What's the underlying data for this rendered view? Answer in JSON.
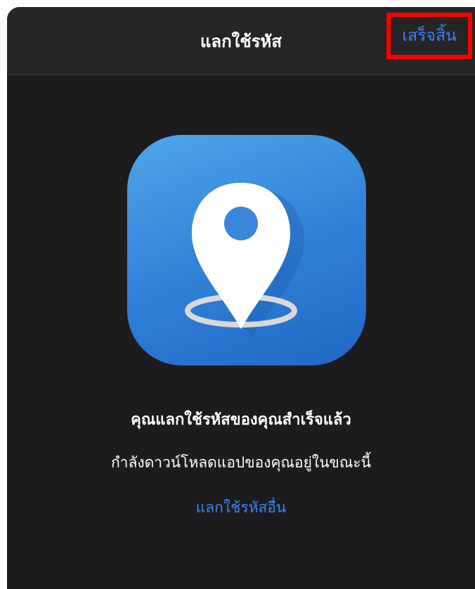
{
  "nav": {
    "title": "แลกใช้รหัส",
    "done_label": "เสร็จสิ้น"
  },
  "app_icon": {
    "icon": "location-pin-icon",
    "gradient_colors": [
      "#4fa6e9",
      "#2068c4"
    ]
  },
  "content": {
    "success_message": "คุณแลกใช้รหัสของคุณสำเร็จแล้ว",
    "download_status": "กำลังดาวน์โหลดแอปของคุณอยู่ในขณะนี้",
    "redeem_another_label": "แลกใช้รหัสอื่น"
  },
  "colors": {
    "background": "#1c1c1e",
    "nav_background": "#252527",
    "accent": "#3b82f6",
    "highlight_border": "#ff0000"
  }
}
